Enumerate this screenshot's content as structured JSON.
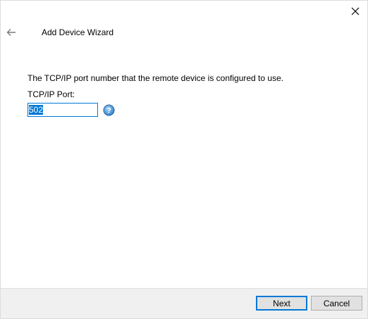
{
  "window": {
    "title": "Add Device Wizard",
    "close_icon": "close-icon",
    "back_icon": "back-arrow-icon"
  },
  "content": {
    "description": "The TCP/IP port number that the remote device is configured to use.",
    "port_label": "TCP/IP Port:",
    "port_value": "502",
    "help_icon": "help-icon"
  },
  "footer": {
    "next_label": "Next",
    "cancel_label": "Cancel"
  },
  "colors": {
    "accent": "#0078d7",
    "footer_bg": "#f0f0f0",
    "button_bg": "#e1e1e1"
  }
}
